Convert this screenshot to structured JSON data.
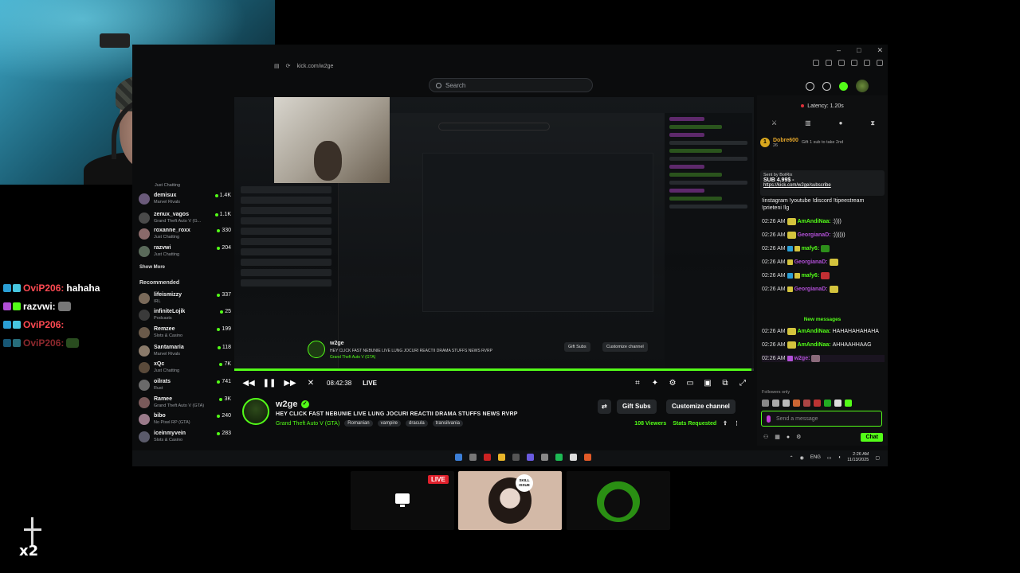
{
  "browser": {
    "url": "kick.com/w2ge",
    "search_placeholder": "Search"
  },
  "overlay_chat": [
    {
      "name": "OviP206:",
      "name_color": "#ff4a52",
      "message": "hahaha"
    },
    {
      "name": "razvwi:",
      "name_color": "#ffffff",
      "message": ""
    },
    {
      "name": "OviP206:",
      "name_color": "#ff4a52",
      "message": ""
    },
    {
      "name": "OviP206:",
      "name_color": "#ff4a52",
      "message": ""
    }
  ],
  "overlay_label": "x2",
  "sidebar": {
    "top_category": "Just Chatting",
    "following": [
      {
        "name": "demisux",
        "category": "Marvel Rivals",
        "viewers": "1.4K"
      },
      {
        "name": "zenux_vagos",
        "category": "Grand Theft Auto V (G...",
        "viewers": "1.1K"
      },
      {
        "name": "roxanne_roxx",
        "category": "Just Chatting",
        "viewers": "330"
      },
      {
        "name": "razvwi",
        "category": "Just Chatting",
        "viewers": "204"
      }
    ],
    "show_more": "Show More",
    "recommended_heading": "Recommended",
    "recommended": [
      {
        "name": "lifeismizzy",
        "category": "IRL",
        "viewers": "337"
      },
      {
        "name": "infiniteLojik",
        "category": "Podcasts",
        "viewers": "25"
      },
      {
        "name": "Remzee",
        "category": "Slots & Casino",
        "viewers": "199"
      },
      {
        "name": "Santamaria",
        "category": "Marvel Rivals",
        "viewers": "118"
      },
      {
        "name": "xQc",
        "category": "Just Chatting",
        "viewers": "7K"
      },
      {
        "name": "oilrats",
        "category": "Rust",
        "viewers": "741"
      },
      {
        "name": "Ramee",
        "category": "Grand Theft Auto V (GTA)",
        "viewers": "3K"
      },
      {
        "name": "bibo",
        "category": "No Pixel RP (GTA)",
        "viewers": "240"
      },
      {
        "name": "iceinmyvein",
        "category": "Slots & Casino",
        "viewers": "283"
      }
    ]
  },
  "player": {
    "time": "08:42:38",
    "live_label": "LIVE",
    "progress": 0.995
  },
  "channel": {
    "name": "w2ge",
    "title": "HEY CLICK FAST NEBUNIE LIVE LUNG JOCURI REACTII DRAMA STUFFS NEWS RVRP",
    "category": "Grand Theft Auto V (GTA)",
    "tags": [
      "Romanian",
      "vampire",
      "dracula",
      "transilvania"
    ],
    "gift_subs": "Gift Subs",
    "customize": "Customize channel",
    "viewers": "108 Viewers",
    "stats": "Stats Requested"
  },
  "chat": {
    "latency": "Latency: 1.20s",
    "pinned_name": "Dobre600",
    "pinned_sub": "26",
    "pinned_gift": "Gift 1 sub to take 2nd",
    "sub_card": {
      "sent_by": "Sent by",
      "bot": "BotRix",
      "price": "SUB 4.99$ -",
      "link": "https://kick.com/w2ge/subscribe"
    },
    "sub_text": "!instagram !youtube !discord !tipeestream !prieteni !lg",
    "messages": [
      {
        "ts": "02:26 AM",
        "user": "AmAndiNaa:",
        "color": "#53fc18",
        "text": ":))))"
      },
      {
        "ts": "02:26 AM",
        "user": "GeorgianaD:",
        "color": "#b14fd6",
        "text": ":))))))"
      },
      {
        "ts": "02:26 AM",
        "user": "mafy6:",
        "color": "#53fc18",
        "text": ""
      },
      {
        "ts": "02:26 AM",
        "user": "GeorgianaD:",
        "color": "#b14fd6",
        "text": ""
      },
      {
        "ts": "02:26 AM",
        "user": "mafy6:",
        "color": "#53fc18",
        "text": ""
      },
      {
        "ts": "02:26 AM",
        "user": "GeorgianaD:",
        "color": "#b14fd6",
        "text": ""
      }
    ],
    "new_messages": "New messages",
    "after": [
      {
        "ts": "02:26 AM",
        "user": "AmAndiNaa:",
        "color": "#53fc18",
        "text": "HAHAHAHAHAHA"
      },
      {
        "ts": "02:26 AM",
        "user": "AmAndiNaa:",
        "color": "#53fc18",
        "text": "AHHAAHHAAG"
      },
      {
        "ts": "02:26 AM",
        "user": "w2ge:",
        "color": "#b14fd6",
        "text": ""
      }
    ],
    "followers_only": "Followers only",
    "input_placeholder": "Send a message",
    "chat_button": "Chat"
  },
  "taskbar": {
    "lang": "ENG",
    "time": "2:26 AM",
    "date": "11/13/2025"
  },
  "tiles": {
    "live": "LIVE",
    "skill": "SKILL ISSUE"
  }
}
